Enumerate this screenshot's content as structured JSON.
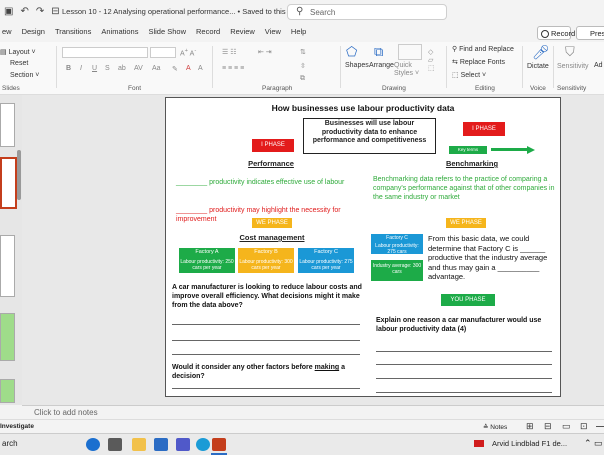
{
  "window": {
    "doc_title": "Lesson 10 - 12 Analysing operational performance... • Saved to this PC ∨",
    "search_placeholder": "Search"
  },
  "menu": {
    "tabs": [
      "ew",
      "Design",
      "Transitions",
      "Animations",
      "Slide Show",
      "Record",
      "Review",
      "View",
      "Help"
    ],
    "record_label": "Record",
    "present_label": "Presen"
  },
  "ribbon": {
    "layout": "Layout ˅",
    "reset": "Reset",
    "section": "Section ˅",
    "slides_group": "Slides",
    "font_group": "Font",
    "paragraph_group": "Paragraph",
    "drawing_group": "Drawing",
    "editing_group": "Editing",
    "voice_group": "Voice",
    "sensitivity_group": "Sensitivity",
    "shapes": "Shapes",
    "arrange": "Arrange",
    "quick_styles": "Quick Styles ˅",
    "find_replace": "Find and Replace",
    "replace_fonts": "Replace Fonts",
    "select": "Select ˅",
    "dictate": "Dictate",
    "sensitivity": "Sensitivity",
    "addins": "Ad",
    "sl": "sl"
  },
  "slide": {
    "title": "How businesses use labour productivity data",
    "center_box": "Businesses will use labour productivity data to enhance performance and competitiveness",
    "i_phase_left": "I PHASE",
    "i_phase_right": "I PHASE",
    "key_terms": "Key terms",
    "performance": "Performance",
    "benchmarking": "Benchmarking",
    "perf_line1": "________ productivity indicates effective use of labour",
    "perf_line2": "________ productivity may highlight the necessity for improvement",
    "bench_text": "Benchmarking data refers to the practice of comparing a company's performance against that of other companies in the same industry or market",
    "we_phase_left": "WE PHASE",
    "we_phase_right": "WE PHASE",
    "cost_management": "Cost management",
    "factories": [
      {
        "name": "Factory A",
        "value": "Labour productivity: 250 cars per year",
        "color": "#1dab48"
      },
      {
        "name": "Factory B",
        "value": "Labour productivity: 300 cars per year",
        "color": "#f5b51c"
      },
      {
        "name": "Factory C",
        "value": "Labour productivity: 275 cars per year",
        "color": "#1b98d6"
      }
    ],
    "right_factory_c_title": "Factory C",
    "right_factory_c_value": "Labour productivity: 275 cars",
    "industry_avg": "Industry average: 300 cars",
    "determine_text": "From this basic data, we could determine that Factory C is ______ productive that the industry average and thus may gain a __________ advantage.",
    "question_left": "A car manufacturer is looking to reduce labour costs and improve overall efficiency. What decisions might it make from the data above?",
    "question_left2_pre": "Would it consider any other factors before ",
    "question_left2_ul": "making",
    "question_left2_post": " a decision?",
    "you_phase": "YOU PHASE",
    "question_right": "Explain one reason a car manufacturer would use labour productivity data (4)"
  },
  "notes": {
    "placeholder": "Click to add notes"
  },
  "status": {
    "left": "Investigate",
    "notes_btn": "Notes",
    "user": "Arvid Lindblad F1 de..."
  },
  "taskbar": {
    "search": "arch"
  }
}
